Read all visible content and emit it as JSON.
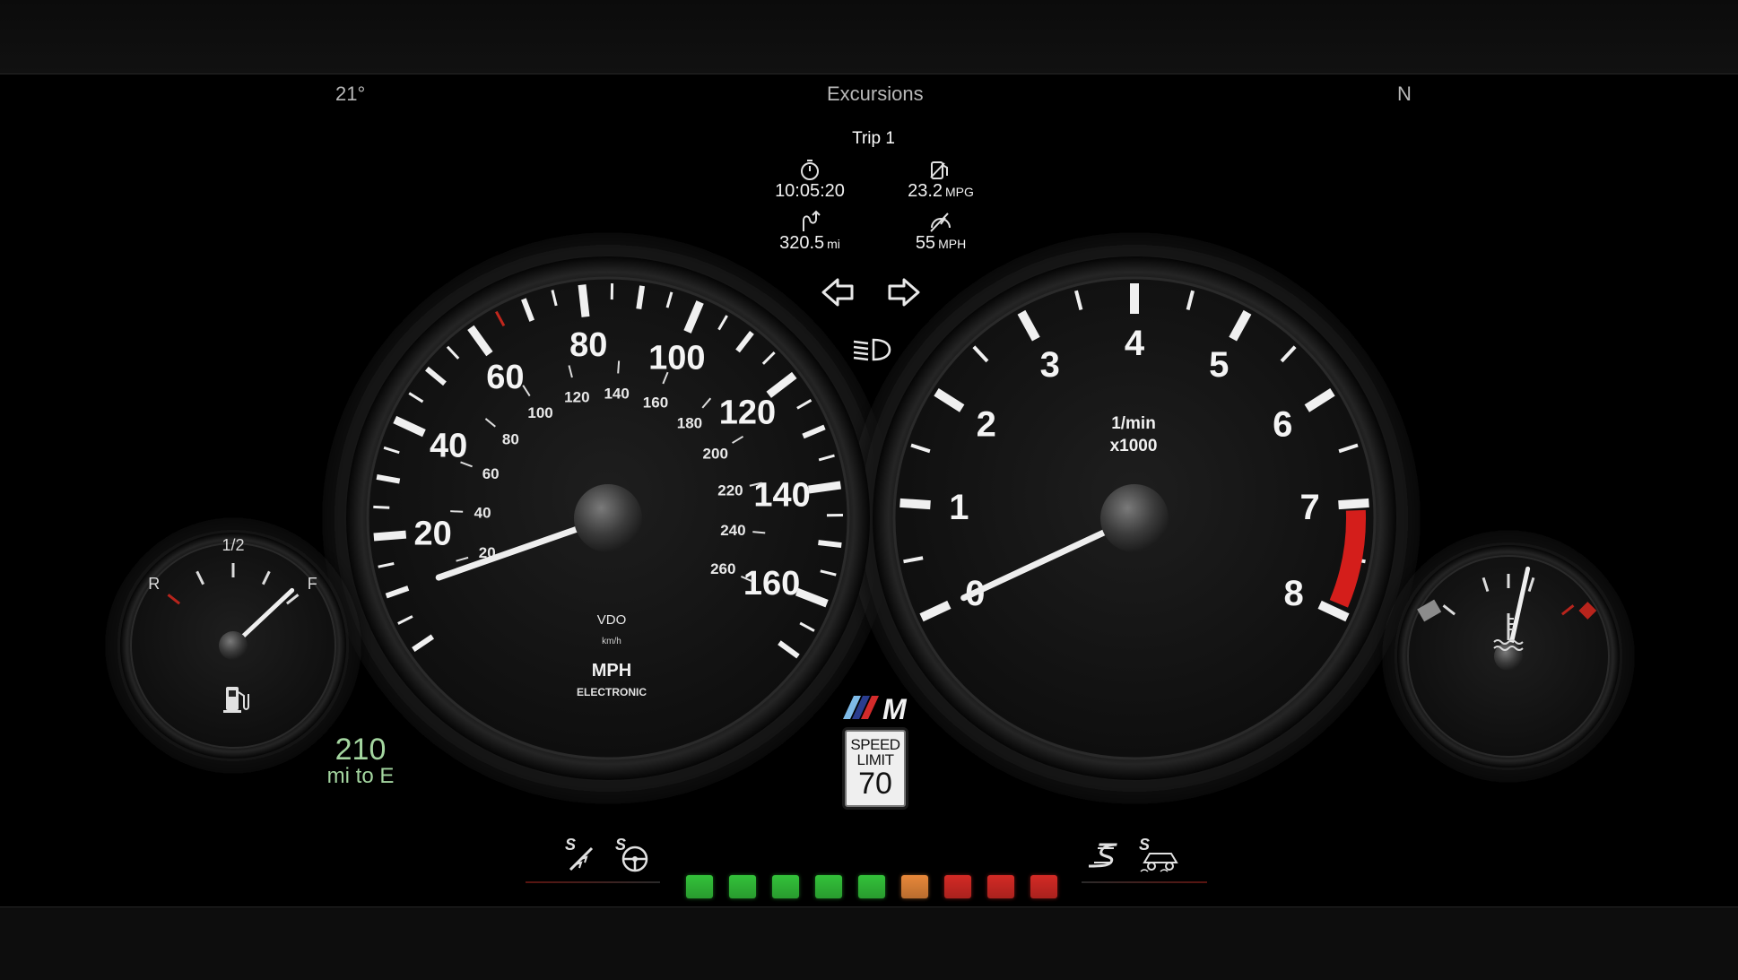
{
  "header": {
    "temperature": "21°",
    "profile": "Excursions",
    "gear": "N"
  },
  "trip": {
    "title": "Trip 1",
    "time": {
      "icon": "stopwatch-icon",
      "value": "10:05:20"
    },
    "fuel_economy": {
      "icon": "fuel-economy-icon",
      "value": "23.2",
      "unit": "MPG"
    },
    "distance": {
      "icon": "route-icon",
      "value": "320.5",
      "unit": "mi"
    },
    "avg_speed": {
      "icon": "average-speed-icon",
      "value": "55",
      "unit": "MPH"
    }
  },
  "indicators": {
    "turn_left": "turn-left-arrow-icon",
    "turn_right": "turn-right-arrow-icon",
    "headlight": "low-beam-headlight-icon"
  },
  "speedometer": {
    "mph_labels": [
      "20",
      "40",
      "60",
      "80",
      "100",
      "120",
      "140",
      "160"
    ],
    "kmh_labels": [
      "20",
      "40",
      "60",
      "80",
      "100",
      "120",
      "140",
      "160",
      "180",
      "200",
      "220",
      "240",
      "260"
    ],
    "brand": "VDO",
    "kmh_unit": "km/h",
    "unit": "MPH",
    "subtitle": "ELECTRONIC",
    "needle_mph": 10
  },
  "tachometer": {
    "labels": [
      "0",
      "1",
      "2",
      "3",
      "4",
      "5",
      "6",
      "7",
      "8"
    ],
    "unit_line1": "1/min",
    "unit_line2": "x1000",
    "redline_from": 7,
    "needle_rpm": 0
  },
  "fuel_gauge": {
    "labels": [
      "R",
      "1/2",
      "F"
    ],
    "icon": "fuel-pump-icon",
    "level": 0.95
  },
  "temp_gauge": {
    "icon": "coolant-temperature-icon",
    "level": 0.62
  },
  "range": {
    "value": "210",
    "label": "mi to E"
  },
  "speed_limit": {
    "line1": "SPEED",
    "line2": "LIMIT",
    "value": "70"
  },
  "logo": "M",
  "drive_modes": {
    "left": [
      "suspension-sport-icon",
      "steering-sport-icon"
    ],
    "right": [
      "engine-sport-icon",
      "dsc-traction-icon"
    ]
  },
  "shift_lights": [
    "#33c23a",
    "#33c23a",
    "#33c23a",
    "#33c23a",
    "#33c23a",
    "#e8883a",
    "#d42a25",
    "#d42a25",
    "#d42a25"
  ],
  "colors": {
    "range_text": "#a4d6a0",
    "redline": "#d41e1b",
    "accent_red": "#d42a25"
  }
}
